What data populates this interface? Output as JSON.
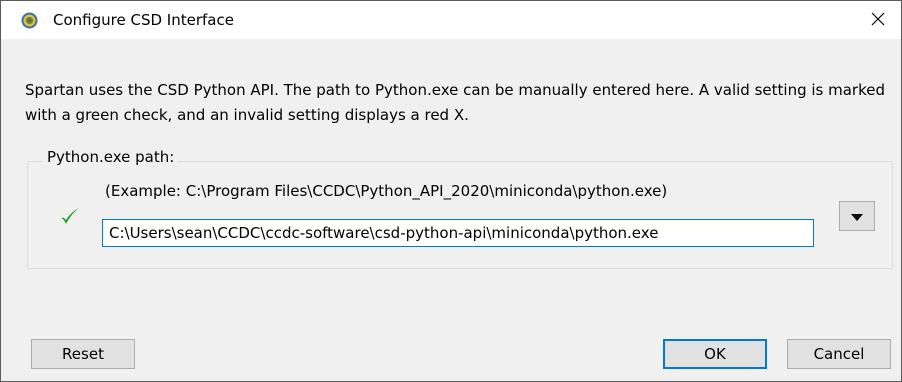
{
  "window": {
    "title": "Configure CSD Interface"
  },
  "description": "Spartan uses the CSD Python API. The path to Python.exe can be manually entered here. A valid setting is marked with a green check, and an invalid setting displays a red X.",
  "python_path_group": {
    "label": "Python.exe path:",
    "example": "(Example: C:\\Program Files\\CCDC\\Python_API_2020\\miniconda\\python.exe)",
    "path_value": "C:\\Users\\sean\\CCDC\\ccdc-software\\csd-python-api\\miniconda\\python.exe",
    "status_icon": "green-check-icon",
    "status_color": "#1ea01e"
  },
  "buttons": {
    "reset": "Reset",
    "ok": "OK",
    "cancel": "Cancel"
  },
  "colors": {
    "accent": "#0078d7",
    "dialog_bg": "#f0f0f0"
  }
}
